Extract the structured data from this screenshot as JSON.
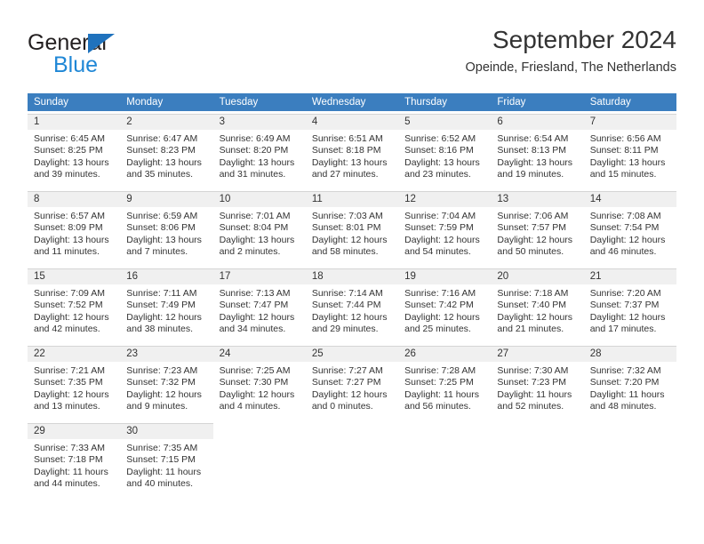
{
  "logo": {
    "word_top": "General",
    "word_bottom": "Blue",
    "triangle_color": "#1f72bd",
    "blue_color": "#1f87d6"
  },
  "header": {
    "title": "September 2024",
    "location": "Opeinde, Friesland, The Netherlands"
  },
  "theme": {
    "header_blue": "#3b7ebf",
    "daynum_gray": "#f0f0f0",
    "text": "#333333"
  },
  "weekdays": [
    "Sunday",
    "Monday",
    "Tuesday",
    "Wednesday",
    "Thursday",
    "Friday",
    "Saturday"
  ],
  "weeks": [
    [
      {
        "day": "1",
        "sunrise": "Sunrise: 6:45 AM",
        "sunset": "Sunset: 8:25 PM",
        "daylight1": "Daylight: 13 hours",
        "daylight2": "and 39 minutes."
      },
      {
        "day": "2",
        "sunrise": "Sunrise: 6:47 AM",
        "sunset": "Sunset: 8:23 PM",
        "daylight1": "Daylight: 13 hours",
        "daylight2": "and 35 minutes."
      },
      {
        "day": "3",
        "sunrise": "Sunrise: 6:49 AM",
        "sunset": "Sunset: 8:20 PM",
        "daylight1": "Daylight: 13 hours",
        "daylight2": "and 31 minutes."
      },
      {
        "day": "4",
        "sunrise": "Sunrise: 6:51 AM",
        "sunset": "Sunset: 8:18 PM",
        "daylight1": "Daylight: 13 hours",
        "daylight2": "and 27 minutes."
      },
      {
        "day": "5",
        "sunrise": "Sunrise: 6:52 AM",
        "sunset": "Sunset: 8:16 PM",
        "daylight1": "Daylight: 13 hours",
        "daylight2": "and 23 minutes."
      },
      {
        "day": "6",
        "sunrise": "Sunrise: 6:54 AM",
        "sunset": "Sunset: 8:13 PM",
        "daylight1": "Daylight: 13 hours",
        "daylight2": "and 19 minutes."
      },
      {
        "day": "7",
        "sunrise": "Sunrise: 6:56 AM",
        "sunset": "Sunset: 8:11 PM",
        "daylight1": "Daylight: 13 hours",
        "daylight2": "and 15 minutes."
      }
    ],
    [
      {
        "day": "8",
        "sunrise": "Sunrise: 6:57 AM",
        "sunset": "Sunset: 8:09 PM",
        "daylight1": "Daylight: 13 hours",
        "daylight2": "and 11 minutes."
      },
      {
        "day": "9",
        "sunrise": "Sunrise: 6:59 AM",
        "sunset": "Sunset: 8:06 PM",
        "daylight1": "Daylight: 13 hours",
        "daylight2": "and 7 minutes."
      },
      {
        "day": "10",
        "sunrise": "Sunrise: 7:01 AM",
        "sunset": "Sunset: 8:04 PM",
        "daylight1": "Daylight: 13 hours",
        "daylight2": "and 2 minutes."
      },
      {
        "day": "11",
        "sunrise": "Sunrise: 7:03 AM",
        "sunset": "Sunset: 8:01 PM",
        "daylight1": "Daylight: 12 hours",
        "daylight2": "and 58 minutes."
      },
      {
        "day": "12",
        "sunrise": "Sunrise: 7:04 AM",
        "sunset": "Sunset: 7:59 PM",
        "daylight1": "Daylight: 12 hours",
        "daylight2": "and 54 minutes."
      },
      {
        "day": "13",
        "sunrise": "Sunrise: 7:06 AM",
        "sunset": "Sunset: 7:57 PM",
        "daylight1": "Daylight: 12 hours",
        "daylight2": "and 50 minutes."
      },
      {
        "day": "14",
        "sunrise": "Sunrise: 7:08 AM",
        "sunset": "Sunset: 7:54 PM",
        "daylight1": "Daylight: 12 hours",
        "daylight2": "and 46 minutes."
      }
    ],
    [
      {
        "day": "15",
        "sunrise": "Sunrise: 7:09 AM",
        "sunset": "Sunset: 7:52 PM",
        "daylight1": "Daylight: 12 hours",
        "daylight2": "and 42 minutes."
      },
      {
        "day": "16",
        "sunrise": "Sunrise: 7:11 AM",
        "sunset": "Sunset: 7:49 PM",
        "daylight1": "Daylight: 12 hours",
        "daylight2": "and 38 minutes."
      },
      {
        "day": "17",
        "sunrise": "Sunrise: 7:13 AM",
        "sunset": "Sunset: 7:47 PM",
        "daylight1": "Daylight: 12 hours",
        "daylight2": "and 34 minutes."
      },
      {
        "day": "18",
        "sunrise": "Sunrise: 7:14 AM",
        "sunset": "Sunset: 7:44 PM",
        "daylight1": "Daylight: 12 hours",
        "daylight2": "and 29 minutes."
      },
      {
        "day": "19",
        "sunrise": "Sunrise: 7:16 AM",
        "sunset": "Sunset: 7:42 PM",
        "daylight1": "Daylight: 12 hours",
        "daylight2": "and 25 minutes."
      },
      {
        "day": "20",
        "sunrise": "Sunrise: 7:18 AM",
        "sunset": "Sunset: 7:40 PM",
        "daylight1": "Daylight: 12 hours",
        "daylight2": "and 21 minutes."
      },
      {
        "day": "21",
        "sunrise": "Sunrise: 7:20 AM",
        "sunset": "Sunset: 7:37 PM",
        "daylight1": "Daylight: 12 hours",
        "daylight2": "and 17 minutes."
      }
    ],
    [
      {
        "day": "22",
        "sunrise": "Sunrise: 7:21 AM",
        "sunset": "Sunset: 7:35 PM",
        "daylight1": "Daylight: 12 hours",
        "daylight2": "and 13 minutes."
      },
      {
        "day": "23",
        "sunrise": "Sunrise: 7:23 AM",
        "sunset": "Sunset: 7:32 PM",
        "daylight1": "Daylight: 12 hours",
        "daylight2": "and 9 minutes."
      },
      {
        "day": "24",
        "sunrise": "Sunrise: 7:25 AM",
        "sunset": "Sunset: 7:30 PM",
        "daylight1": "Daylight: 12 hours",
        "daylight2": "and 4 minutes."
      },
      {
        "day": "25",
        "sunrise": "Sunrise: 7:27 AM",
        "sunset": "Sunset: 7:27 PM",
        "daylight1": "Daylight: 12 hours",
        "daylight2": "and 0 minutes."
      },
      {
        "day": "26",
        "sunrise": "Sunrise: 7:28 AM",
        "sunset": "Sunset: 7:25 PM",
        "daylight1": "Daylight: 11 hours",
        "daylight2": "and 56 minutes."
      },
      {
        "day": "27",
        "sunrise": "Sunrise: 7:30 AM",
        "sunset": "Sunset: 7:23 PM",
        "daylight1": "Daylight: 11 hours",
        "daylight2": "and 52 minutes."
      },
      {
        "day": "28",
        "sunrise": "Sunrise: 7:32 AM",
        "sunset": "Sunset: 7:20 PM",
        "daylight1": "Daylight: 11 hours",
        "daylight2": "and 48 minutes."
      }
    ],
    [
      {
        "day": "29",
        "sunrise": "Sunrise: 7:33 AM",
        "sunset": "Sunset: 7:18 PM",
        "daylight1": "Daylight: 11 hours",
        "daylight2": "and 44 minutes."
      },
      {
        "day": "30",
        "sunrise": "Sunrise: 7:35 AM",
        "sunset": "Sunset: 7:15 PM",
        "daylight1": "Daylight: 11 hours",
        "daylight2": "and 40 minutes."
      },
      {
        "day": "",
        "sunrise": "",
        "sunset": "",
        "daylight1": "",
        "daylight2": "",
        "empty": true
      },
      {
        "day": "",
        "sunrise": "",
        "sunset": "",
        "daylight1": "",
        "daylight2": "",
        "empty": true
      },
      {
        "day": "",
        "sunrise": "",
        "sunset": "",
        "daylight1": "",
        "daylight2": "",
        "empty": true
      },
      {
        "day": "",
        "sunrise": "",
        "sunset": "",
        "daylight1": "",
        "daylight2": "",
        "empty": true
      },
      {
        "day": "",
        "sunrise": "",
        "sunset": "",
        "daylight1": "",
        "daylight2": "",
        "empty": true
      }
    ]
  ]
}
